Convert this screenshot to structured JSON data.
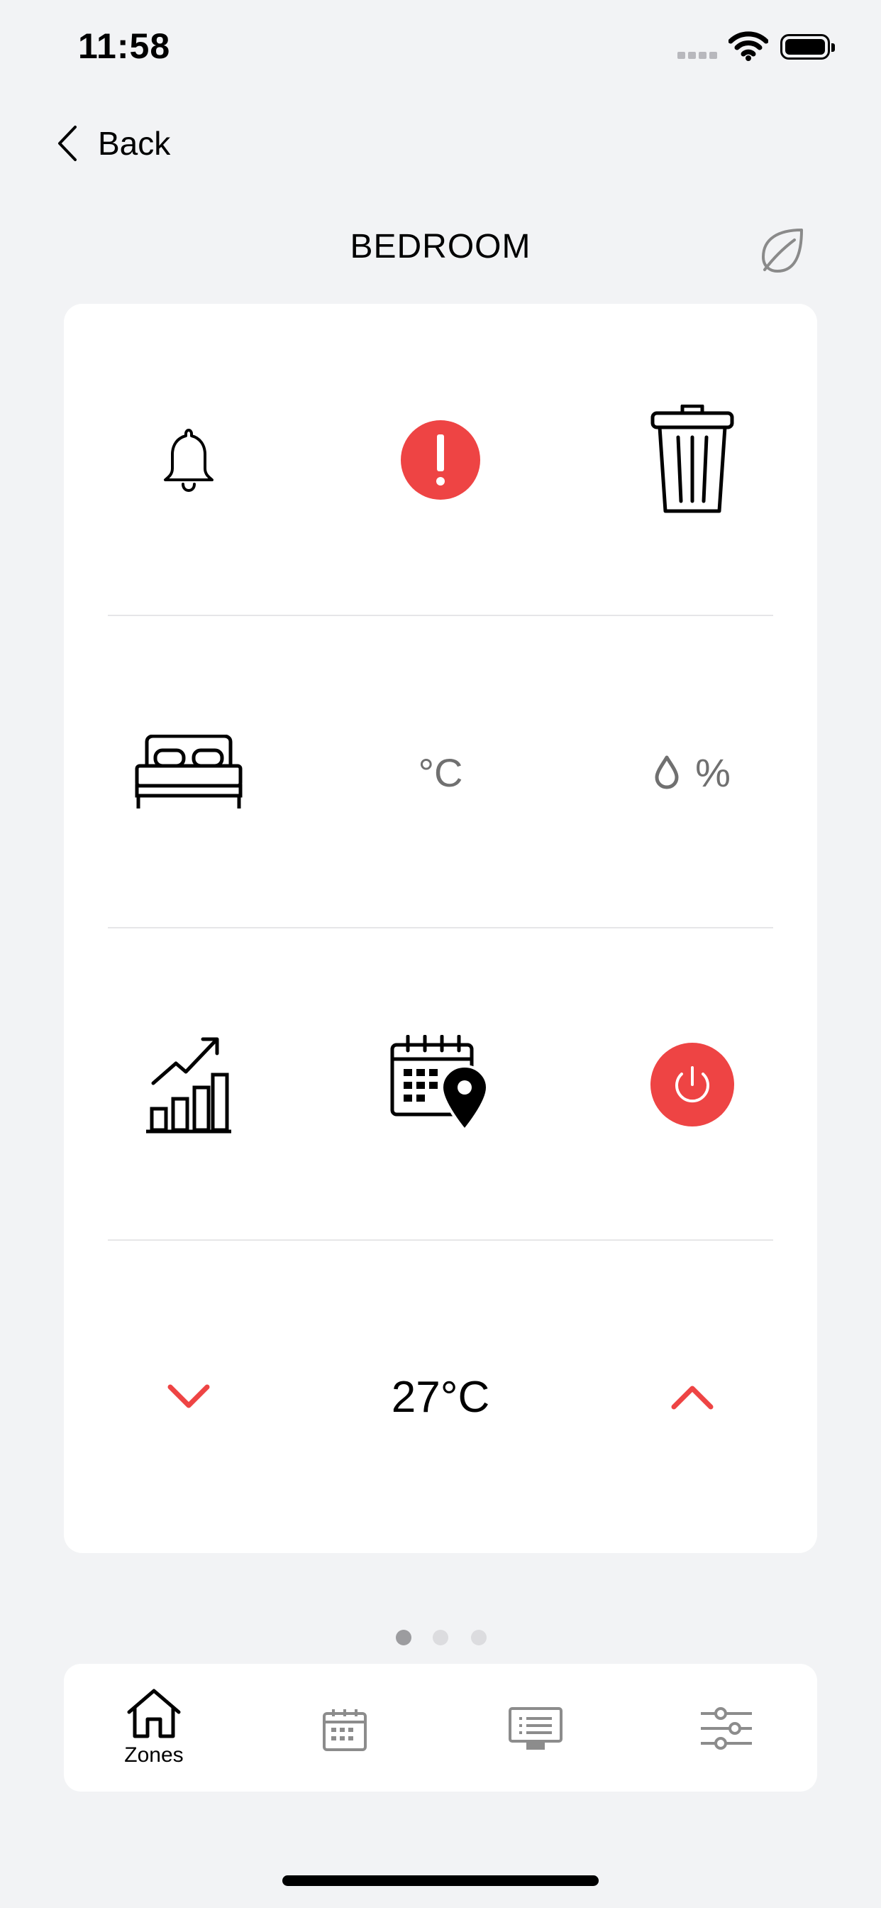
{
  "status": {
    "time": "11:58"
  },
  "nav": {
    "back_label": "Back",
    "title": "BEDROOM"
  },
  "grid": {
    "temp_unit": "°C",
    "humidity_unit": "%",
    "current_temp": "27°C"
  },
  "pager": {
    "count": 3,
    "active_index": 0
  },
  "tabs": [
    {
      "label": "Zones",
      "icon": "home-icon",
      "active": true
    },
    {
      "label": "",
      "icon": "calendar-icon",
      "active": false
    },
    {
      "label": "",
      "icon": "display-list-icon",
      "active": false
    },
    {
      "label": "",
      "icon": "sliders-icon",
      "active": false
    }
  ],
  "colors": {
    "accent": "#ee4444",
    "background": "#f2f3f5",
    "muted": "#707070"
  }
}
